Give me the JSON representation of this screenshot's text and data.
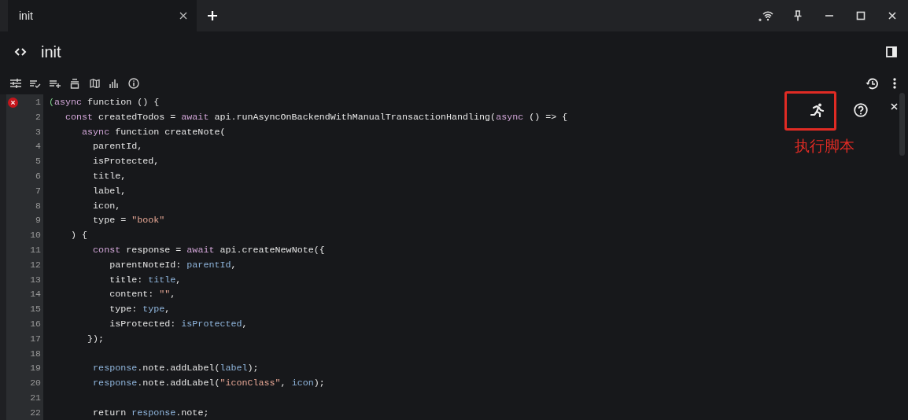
{
  "tabs": [
    {
      "label": "init",
      "selected": true
    }
  ],
  "note": {
    "title": "init"
  },
  "editor": {
    "lines": [
      {
        "number": "1",
        "error": true,
        "tokens": [
          {
            "kind": "bracket",
            "text": "("
          },
          {
            "kind": "keyword",
            "text": "async"
          },
          {
            "kind": "plain",
            "text": " function () {"
          }
        ]
      },
      {
        "number": "2",
        "error": false,
        "tokens": [
          {
            "kind": "keyword",
            "text": "   const"
          },
          {
            "kind": "plain",
            "text": " createdTodos = "
          },
          {
            "kind": "keyword",
            "text": "await"
          },
          {
            "kind": "plain",
            "text": " api.runAsyncOnBackendWithManualTransactionHandling("
          },
          {
            "kind": "keyword",
            "text": "async"
          },
          {
            "kind": "plain",
            "text": " () => {"
          }
        ]
      },
      {
        "number": "3",
        "error": false,
        "tokens": [
          {
            "kind": "keyword",
            "text": "      async"
          },
          {
            "kind": "plain",
            "text": " function createNote("
          }
        ]
      },
      {
        "number": "4",
        "error": false,
        "tokens": [
          {
            "kind": "plain",
            "text": "        parentId,"
          }
        ]
      },
      {
        "number": "5",
        "error": false,
        "tokens": [
          {
            "kind": "plain",
            "text": "        isProtected,"
          }
        ]
      },
      {
        "number": "6",
        "error": false,
        "tokens": [
          {
            "kind": "plain",
            "text": "        title,"
          }
        ]
      },
      {
        "number": "7",
        "error": false,
        "tokens": [
          {
            "kind": "plain",
            "text": "        label,"
          }
        ]
      },
      {
        "number": "8",
        "error": false,
        "tokens": [
          {
            "kind": "plain",
            "text": "        icon,"
          }
        ]
      },
      {
        "number": "9",
        "error": false,
        "tokens": [
          {
            "kind": "plain",
            "text": "        type = "
          },
          {
            "kind": "string",
            "text": "\"book\""
          }
        ]
      },
      {
        "number": "10",
        "error": false,
        "tokens": [
          {
            "kind": "plain",
            "text": "    ) {"
          }
        ]
      },
      {
        "number": "11",
        "error": false,
        "tokens": [
          {
            "kind": "keyword",
            "text": "        const"
          },
          {
            "kind": "plain",
            "text": " response = "
          },
          {
            "kind": "keyword",
            "text": "await"
          },
          {
            "kind": "plain",
            "text": " api.createNewNote({"
          }
        ]
      },
      {
        "number": "12",
        "error": false,
        "tokens": [
          {
            "kind": "plain",
            "text": "           parentNoteId: "
          },
          {
            "kind": "variable",
            "text": "parentId"
          },
          {
            "kind": "plain",
            "text": ","
          }
        ]
      },
      {
        "number": "13",
        "error": false,
        "tokens": [
          {
            "kind": "plain",
            "text": "           title: "
          },
          {
            "kind": "variable",
            "text": "title"
          },
          {
            "kind": "plain",
            "text": ","
          }
        ]
      },
      {
        "number": "14",
        "error": false,
        "tokens": [
          {
            "kind": "plain",
            "text": "           content: "
          },
          {
            "kind": "string",
            "text": "\"\""
          },
          {
            "kind": "plain",
            "text": ","
          }
        ]
      },
      {
        "number": "15",
        "error": false,
        "tokens": [
          {
            "kind": "plain",
            "text": "           type: "
          },
          {
            "kind": "variable",
            "text": "type"
          },
          {
            "kind": "plain",
            "text": ","
          }
        ]
      },
      {
        "number": "16",
        "error": false,
        "tokens": [
          {
            "kind": "plain",
            "text": "           isProtected: "
          },
          {
            "kind": "variable",
            "text": "isProtected"
          },
          {
            "kind": "plain",
            "text": ","
          }
        ]
      },
      {
        "number": "17",
        "error": false,
        "tokens": [
          {
            "kind": "plain",
            "text": "       });"
          }
        ]
      },
      {
        "number": "18",
        "error": false
      },
      {
        "number": "19",
        "error": false,
        "tokens": [
          {
            "kind": "variable",
            "text": "        response"
          },
          {
            "kind": "plain",
            "text": ".note.addLabel("
          },
          {
            "kind": "variable",
            "text": "label"
          },
          {
            "kind": "plain",
            "text": ");"
          }
        ]
      },
      {
        "number": "20",
        "error": false,
        "tokens": [
          {
            "kind": "variable",
            "text": "        response"
          },
          {
            "kind": "plain",
            "text": ".note.addLabel("
          },
          {
            "kind": "string",
            "text": "\"iconClass\""
          },
          {
            "kind": "plain",
            "text": ", "
          },
          {
            "kind": "variable",
            "text": "icon"
          },
          {
            "kind": "plain",
            "text": ");"
          }
        ]
      },
      {
        "number": "21",
        "error": false
      },
      {
        "number": "22",
        "error": false,
        "tokens": [
          {
            "kind": "plain",
            "text": "        return "
          },
          {
            "kind": "variable",
            "text": "response"
          },
          {
            "kind": "plain",
            "text": ".note;"
          }
        ]
      }
    ]
  },
  "annotation": {
    "label": "执行脚本"
  }
}
